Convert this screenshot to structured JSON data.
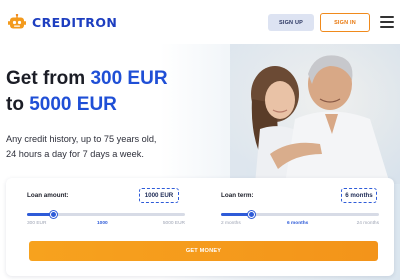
{
  "brand": {
    "name": "CREDITRON",
    "color": "#1d3ec0"
  },
  "header": {
    "signup_label": "SIGN UP",
    "signin_label": "SIGN IN"
  },
  "hero": {
    "headline_prefix": "Get from ",
    "headline_min": "300 EUR",
    "headline_line2_prefix": "to ",
    "headline_max": "5000 EUR",
    "subtext_line1": "Any credit history, up to 75 years old,",
    "subtext_line2": "24 hours a day for 7 days a week."
  },
  "calculator": {
    "amount": {
      "label": "Loan amount:",
      "value_display": "1000 EUR",
      "min_label": "300 EUR",
      "mid_label": "1000",
      "max_label": "5000 EUR",
      "min": 300,
      "max": 5000,
      "value": 1000
    },
    "term": {
      "label": "Loan term:",
      "value_display": "6 months",
      "min_label": "2 months",
      "mid_label": "6 months",
      "max_label": "24 months",
      "min": 2,
      "max": 24,
      "value": 6
    },
    "cta_label": "GET MONEY"
  },
  "colors": {
    "accent": "#1f4fd6",
    "cta": "#f39a1c",
    "signin_border": "#f08a1c"
  }
}
